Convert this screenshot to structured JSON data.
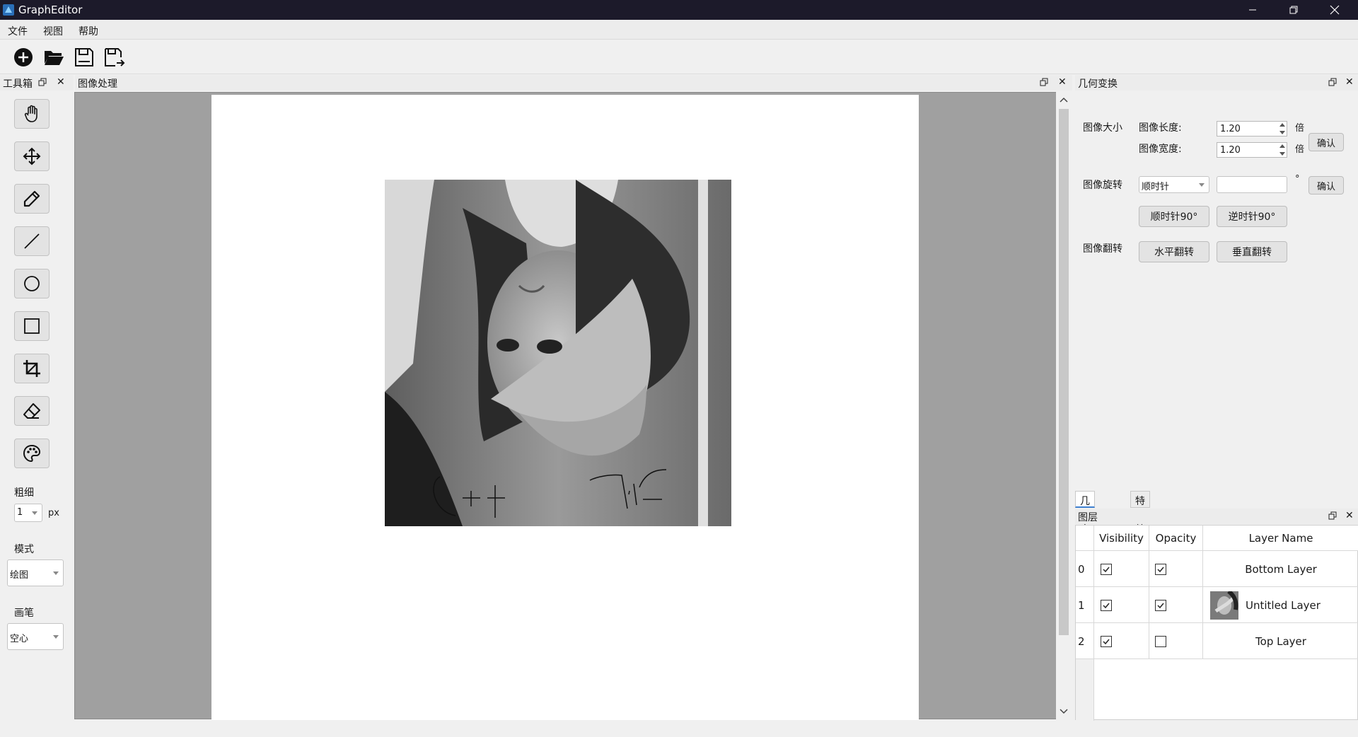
{
  "window": {
    "title": "GraphEditor"
  },
  "menu": [
    "文件",
    "视图",
    "帮助"
  ],
  "toolbox": {
    "title": "工具箱",
    "thickness_label": "粗细",
    "thickness_value": "1",
    "thickness_unit": "px",
    "mode_label": "模式",
    "mode_value": "绘图",
    "brush_label": "画笔",
    "brush_value": "空心"
  },
  "canvas": {
    "title": "图像处理"
  },
  "geometry": {
    "title": "几何变换",
    "size_label": "图像大小",
    "length_label": "图像长度:",
    "length_value": "1.20",
    "width_label": "图像宽度:",
    "width_value": "1.20",
    "times_unit": "倍",
    "confirm": "确认",
    "rotate_label": "图像旋转",
    "rotate_direction": "顺时针",
    "rotate_angle": "",
    "degree_unit": "°",
    "cw90": "顺时针90°",
    "ccw90": "逆时针90°",
    "flip_label": "图像翻转",
    "flip_h": "水平翻转",
    "flip_v": "垂直翻转"
  },
  "tabs": [
    "几何变换",
    "特殊效果"
  ],
  "layers": {
    "title": "图层",
    "headers": [
      "Visibility",
      "Opacity",
      "Layer Name"
    ],
    "rows": [
      {
        "index": "0",
        "visible": true,
        "opacity": true,
        "name": "Bottom Layer",
        "thumb": false
      },
      {
        "index": "1",
        "visible": true,
        "opacity": true,
        "name": "Untitled Layer",
        "thumb": true
      },
      {
        "index": "2",
        "visible": true,
        "opacity": false,
        "name": "Top Layer",
        "thumb": false
      }
    ]
  },
  "drawing_text": [
    "C+t",
    "7.15"
  ],
  "colors": {
    "titlebar": "#1c1a2a",
    "canvas_bg": "#a0a0a0",
    "accent": "#3c7fd0"
  }
}
